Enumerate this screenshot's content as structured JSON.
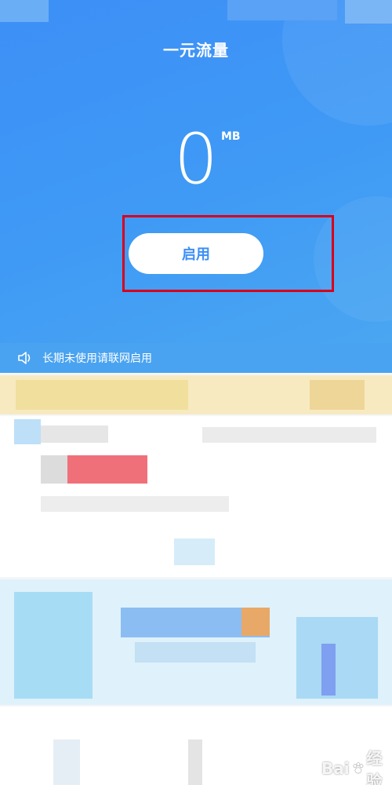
{
  "header": {
    "title": "一元流量"
  },
  "balance": {
    "amount": "0",
    "unit": "MB"
  },
  "actions": {
    "enable_label": "启用"
  },
  "notice": {
    "text": "长期未使用请联网启用",
    "icon": "speaker-icon"
  },
  "watermark": {
    "left": "Bai",
    "right": "经验"
  },
  "colors": {
    "primary": "#3d8ff6",
    "highlight": "#d9001b",
    "banner": "#f7eac0"
  }
}
